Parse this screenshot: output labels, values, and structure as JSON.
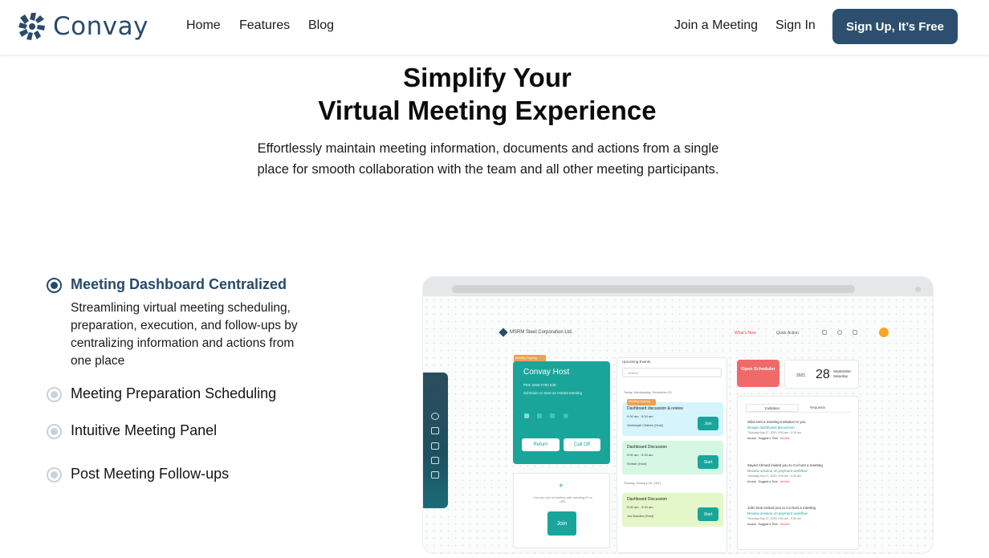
{
  "header": {
    "logo_text": "Convay",
    "nav": {
      "home": "Home",
      "features": "Features",
      "blog": "Blog",
      "join": "Join a Meeting",
      "signin": "Sign In",
      "signup": "Sign Up, It’s Free"
    }
  },
  "hero": {
    "title_line1": "Simplify Your",
    "title_line2": "Virtual Meeting Experience",
    "subtitle": "Effortlessly maintain meeting information, documents and actions from a single place for smooth collaboration with the team and all other meeting participants."
  },
  "features": {
    "items": [
      {
        "title": "Meeting Dashboard Centralized",
        "active": true
      },
      {
        "title": "Meeting Preparation Scheduling",
        "active": false
      },
      {
        "title": "Intuitive Meeting Panel",
        "active": false
      },
      {
        "title": "Post Meeting Follow-ups",
        "active": false
      }
    ],
    "active_description": "Streamlining virtual meeting scheduling, preparation, execution, and follow-ups by centralizing information and actions from one place"
  },
  "mockup": {
    "org": "MSRM Steel Corporation Ltd.",
    "whats_new": "What’s New",
    "quick_action": "Quick Action",
    "host": {
      "tag": "Meeting Ongoing",
      "title": "Convay Host",
      "pmi": "PMI: 3459 0790 648",
      "schedule": "Schedule or Start an Instant Meeting",
      "return": "Return",
      "call_off": "Call Off"
    },
    "join_card": {
      "hint": "You can join a meeting with meeting ID or URL",
      "button": "Join"
    },
    "events": {
      "heading": "Upcoming Events",
      "search_placeholder": "Search",
      "date1": "Today, Wednesday, December 29",
      "date2": "Sunday, January 29, 2021",
      "ongoing_tag": "Meeting Ongoing",
      "cards": [
        {
          "title": "Dashboard discussion & review",
          "time": "9:00 am - 9:30 am",
          "host": "Geetanjali Chithee (Host)",
          "button": "Join"
        },
        {
          "title": "Dashboard Discussion",
          "time": "9:00 am - 9:30 am",
          "host": "Shihab (Host)",
          "button": "Start"
        },
        {
          "title": "Dashboard Discussion",
          "time": "9:00 am - 9:30 am",
          "host": "Joe Basden (Host)",
          "button": "Start"
        }
      ]
    },
    "scheduler": "Open Scheduler",
    "date": {
      "year": "2021",
      "day": "28",
      "month": "September",
      "weekday": "Saturday"
    },
    "invitations": {
      "tab1": "Invitation",
      "tab2": "Requests",
      "items": [
        {
          "text": "Sifat sent a meeting Invitation to you",
          "link": "Design dashboard discussion",
          "when": "Thursday Sep 27, 2020, 9:00 am - 9:30 am",
          "accept": "Accept",
          "suggest": "Suggest a Time",
          "decline": "Decline"
        },
        {
          "text": "Sayed Ahmed invited you to Co-host a meeting",
          "link": "Review session on payment workflow",
          "when": "Thursday Sep 27, 2020, 9:00 am - 9:30 am",
          "accept": "Accept",
          "suggest": "Suggest a Time",
          "decline": "Decline"
        },
        {
          "text": "John Doe invited you to Co-host a meeting",
          "link": "Review session on payment workflow",
          "when": "Thursday Sep 27, 2020, 9:00 am - 9:30 am",
          "accept": "Accept",
          "suggest": "Suggest a Time",
          "decline": "Decline"
        }
      ]
    }
  },
  "colors": {
    "brand": "#2c4f6f",
    "accent_teal": "#1aa59b",
    "radio_active": "#264a6b",
    "radio_inactive": "#c8d2dc"
  }
}
